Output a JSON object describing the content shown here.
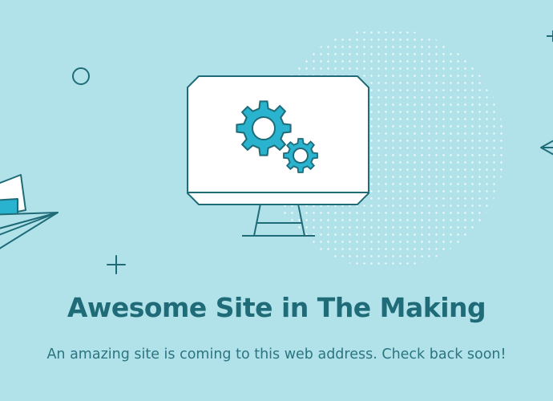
{
  "page": {
    "title": "Awesome Site in The Making",
    "message": "An amazing site is coming to this web address. Check back soon!"
  },
  "colors": {
    "background": "#b1e2ea",
    "line": "#1f6c78",
    "gear": "#29b3cf",
    "screen": "#ffffff",
    "dots": "#ffffff"
  },
  "icons": {
    "hero": "monitor-with-gears-icon",
    "decorations": [
      "circle-outline-icon",
      "plus-icon",
      "paper-plane-left-icon",
      "paper-plane-right-icon"
    ]
  }
}
